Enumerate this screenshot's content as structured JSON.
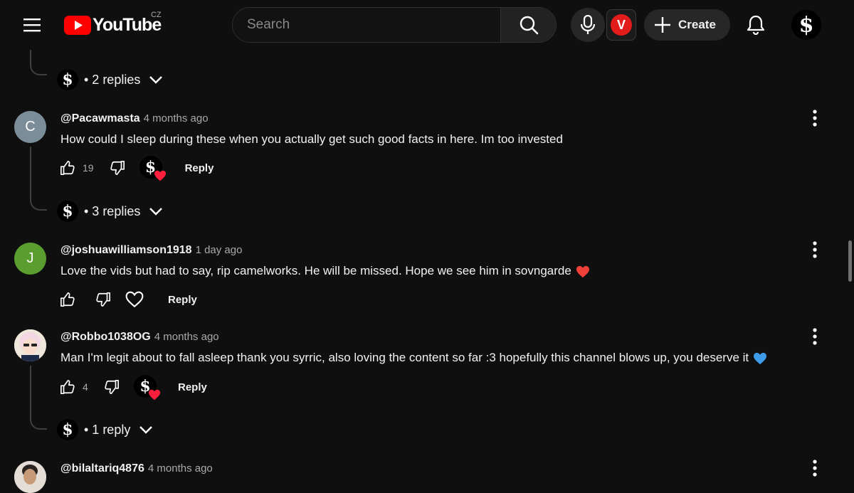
{
  "header": {
    "logo_text": "YouTube",
    "country_code": "CZ",
    "search_placeholder": "Search",
    "create_label": "Create",
    "extension_letter": "V",
    "brand_color": "#ff0000"
  },
  "thread_top": {
    "replies_label": "• 2 replies"
  },
  "comments": [
    {
      "handle": "@Pacawmasta",
      "time": "4 months ago",
      "text": "How could I sleep during these when you actually get such good facts in here. Im too invested",
      "avatar_letter": "C",
      "avatar_color": "#7a8d99",
      "likes": "19",
      "reply_label": "Reply",
      "creator_hearted": true,
      "replies_label": "• 3 replies"
    },
    {
      "handle": "@joshuawilliamson1918",
      "time": "1 day ago",
      "text": "Love the vids but had to say, rip camelworks. He will be missed. Hope we see him in sovngarde",
      "emoji": "red-heart",
      "avatar_letter": "J",
      "avatar_color": "#5a9e2f",
      "likes": "",
      "reply_label": "Reply",
      "creator_hearted": false
    },
    {
      "handle": "@Robbo1038OG",
      "time": "4 months ago",
      "text": "Man I'm legit about to fall asleep thank you syrric, also loving the content so far :3 hopefully this channel blows up, you deserve it",
      "emoji": "blue-heart",
      "likes": "4",
      "reply_label": "Reply",
      "creator_hearted": true,
      "replies_label": "• 1 reply"
    },
    {
      "handle": "@bilaltariq4876",
      "time": "4 months ago"
    }
  ]
}
